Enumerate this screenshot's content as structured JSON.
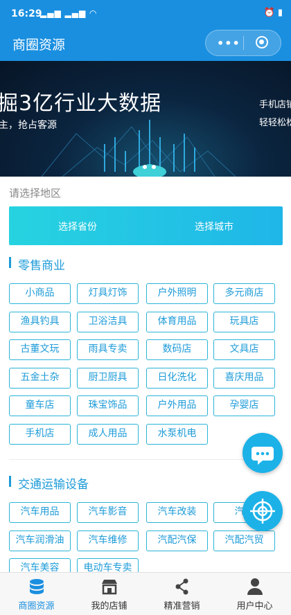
{
  "status": {
    "time": "16:29",
    "signal": "▂▄▆ ▂▄▆ ◠",
    "right": "⏰ ▮"
  },
  "nav": {
    "title": "商圈资源",
    "menu": "•••"
  },
  "banner": {
    "headline": "掘3亿行业大数据",
    "subline": "主，抢占客源",
    "side_line1": "手机店铺",
    "side_line2": "轻轻松松"
  },
  "region": {
    "label": "请选择地区",
    "province": "选择省份",
    "city": "选择城市"
  },
  "sections": [
    {
      "title": "零售商业",
      "tags": [
        "小商品",
        "灯具灯饰",
        "户外照明",
        "多元商店",
        "渔具钓具",
        "卫浴洁具",
        "体育用品",
        "玩具店",
        "古董文玩",
        "雨具专卖",
        "数码店",
        "文具店",
        "五金土杂",
        "厨卫厨具",
        "日化洗化",
        "喜庆用品",
        "童车店",
        "珠宝饰品",
        "户外用品",
        "孕婴店",
        "手机店",
        "成人用品",
        "水泵机电"
      ]
    },
    {
      "title": "交通运输设备",
      "tags": [
        "汽车用品",
        "汽车影音",
        "汽车改装",
        "汽车",
        "汽车润滑油",
        "汽车维修",
        "汽配汽保",
        "汽配汽贸",
        "汽车美容",
        "电动车专卖"
      ]
    }
  ],
  "tabbar": [
    {
      "label": "商圈资源",
      "icon": "database-icon",
      "active": true
    },
    {
      "label": "我的店铺",
      "icon": "shop-icon",
      "active": false
    },
    {
      "label": "精准营销",
      "icon": "share-icon",
      "active": false
    },
    {
      "label": "用户中心",
      "icon": "user-icon",
      "active": false
    }
  ],
  "colors": {
    "primary": "#1a8fe0",
    "accent": "#1d9bd8",
    "tag_border": "#2ab3d8",
    "gradient_start": "#27d3e0",
    "gradient_end": "#1fb6e8"
  }
}
